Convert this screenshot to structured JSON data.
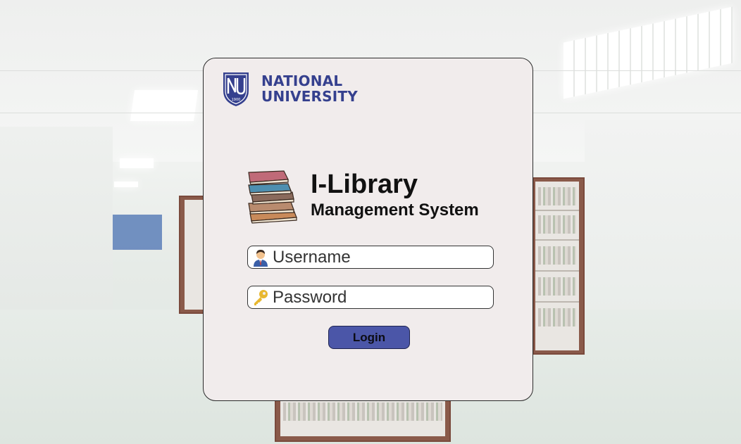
{
  "header": {
    "university_line1": "NATIONAL",
    "university_line2": "UNIVERSITY",
    "shield_year": "1900"
  },
  "app": {
    "title": "I-Library",
    "subtitle": "Management System"
  },
  "form": {
    "username_placeholder": "Username",
    "password_placeholder": "Password",
    "login_label": "Login"
  },
  "icons": {
    "logo": "university-shield-icon",
    "books": "book-stack-icon",
    "username": "user-icon",
    "password": "key-icon"
  },
  "colors": {
    "brand": "#35408e",
    "button": "#4b56a8",
    "card": "#f1ecec"
  }
}
